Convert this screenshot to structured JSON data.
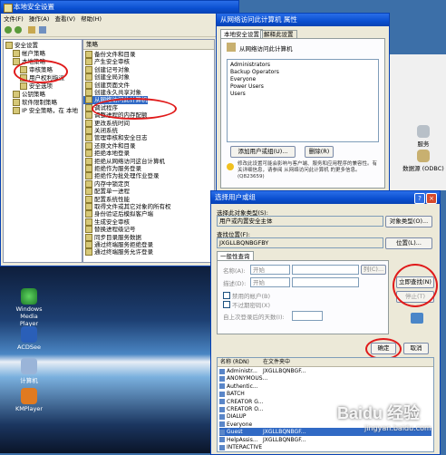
{
  "colors": {
    "title_bar": "#0a4fd0",
    "window_bg": "#ece9d8",
    "highlight_red": "#e01a1a",
    "selected": "#316ac5"
  },
  "main_window": {
    "title": "本地安全设置",
    "menu": [
      "文件(F)",
      "操作(A)",
      "查看(V)",
      "帮助(H)"
    ],
    "tree_header": "安全设置",
    "tree_items": [
      "帐户策略",
      "本地策略",
      "审核策略",
      "用户权利指派",
      "安全选项",
      "公钥策略",
      "软件限制策略",
      "IP 安全策略，在 本地"
    ],
    "policy_header": "策略",
    "policies": [
      "备份文件和目录",
      "产生安全审核",
      "创建记号对象",
      "创建全局对象",
      "创建页面文件",
      "创建永久共享对象",
      "从网络访问此计算机",
      "调试程序",
      "调整进程的内存配额",
      "更改系统时间",
      "关闭系统",
      "管理审核和安全日志",
      "还原文件和目录",
      "拒绝本地登录",
      "拒绝从网络访问这台计算机",
      "拒绝作为服务登录",
      "拒绝作为批处理作业登录",
      "内存中锁定页",
      "配置单一进程",
      "配置系统性能",
      "取得文件或其它对象的所有权",
      "身份验证后模拟客户端",
      "生成安全审核",
      "替换进程级记号",
      "同步目录服务数据",
      "通过终端服务拒绝登录",
      "通过终端服务允许登录"
    ]
  },
  "props_dialog": {
    "title": "从网络访问此计算机 属性",
    "tabs": [
      "本地安全设置",
      "解释此设置"
    ],
    "policy_name": "从网络访问此计算机",
    "members": [
      "Administrators",
      "Backup Operators",
      "Everyone",
      "Power Users",
      "Users"
    ],
    "add_button": "添加用户或组(U)...",
    "remove_button": "删除(R)",
    "note": "修改此设置可能会影响与客户端、服务和应用程序的兼容性。有关详细信息，请参阅 从网络访问此计算机 的更多信息。(Q823659)"
  },
  "select_dialog": {
    "title": "选择用户或组",
    "object_type_label": "选择此对象类型(S):",
    "object_type_value": "用户或内置安全主体",
    "object_type_button": "对象类型(O)...",
    "location_label": "查找位置(F):",
    "location_value": "JXGLLBQNBGFBY",
    "location_button": "位置(L)...",
    "tab_common": "一般性查询",
    "name_label": "名称(A):",
    "desc_label": "描述(D):",
    "name_op": "开始",
    "desc_op": "开始",
    "disabled_chk": "禁用的帐户(B)",
    "nonexp_chk": "不过期密码(X)",
    "days_label": "自上次登录后的天数(I):",
    "columns_button": "列(C)...",
    "find_button": "立即查找(N)",
    "stop_button": "停止(T)",
    "ok_button": "确定",
    "cancel_button": "取消",
    "results_header": [
      "名称 (RDN)",
      "在文件夹中"
    ],
    "results": [
      {
        "name": "Administr...",
        "folder": "JXGLLBQNBGF..."
      },
      {
        "name": "ANONYMOUS...",
        "folder": ""
      },
      {
        "name": "Authentic...",
        "folder": ""
      },
      {
        "name": "BATCH",
        "folder": ""
      },
      {
        "name": "CREATOR G...",
        "folder": ""
      },
      {
        "name": "CREATOR O...",
        "folder": ""
      },
      {
        "name": "DIALUP",
        "folder": ""
      },
      {
        "name": "Everyone",
        "folder": ""
      },
      {
        "name": "Guest",
        "folder": "JXGLLBQNBGF..."
      },
      {
        "name": "HelpAssis...",
        "folder": "JXGLLBQNBGF..."
      },
      {
        "name": "INTERACTIVE",
        "folder": ""
      }
    ]
  },
  "desktop": {
    "icons": [
      {
        "label": "Windows Media Player",
        "glyph": "media-icon"
      },
      {
        "label": "ACDSee",
        "glyph": "acdsee-icon"
      },
      {
        "label": "计算机",
        "glyph": "computer-icon"
      },
      {
        "label": "KMPlayer",
        "glyph": "player-icon"
      }
    ],
    "right_icons": [
      {
        "label": "服务"
      },
      {
        "label": "数据源 (ODBC)"
      }
    ]
  },
  "watermark": {
    "brand": "Baidu 经验",
    "url": "jingyan.baidu.com"
  }
}
